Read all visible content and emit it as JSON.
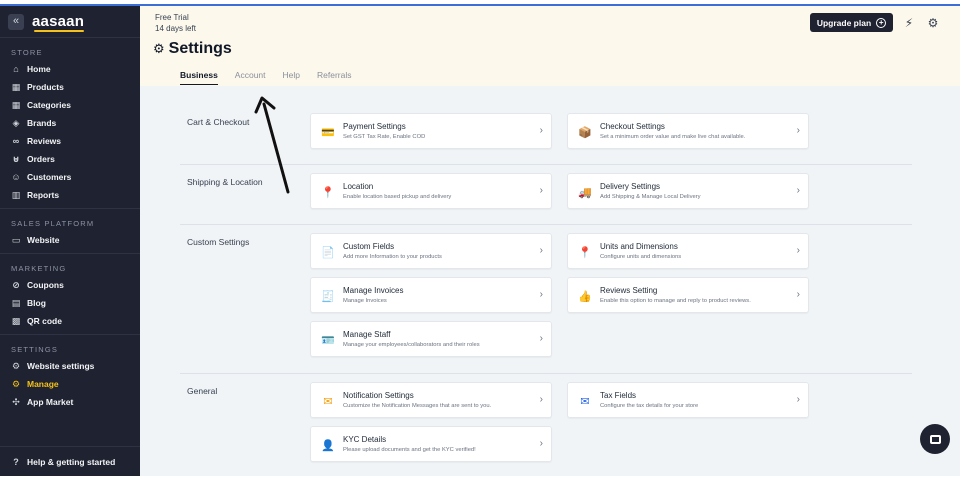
{
  "sidebar": {
    "logo": "aasaan",
    "collapse_icon": "chevrons-left-icon",
    "sections": [
      {
        "title": "STORE",
        "items": [
          {
            "label": "Home",
            "icon": "home-icon",
            "glyph": "⌂"
          },
          {
            "label": "Products",
            "icon": "grid-icon",
            "glyph": "▦"
          },
          {
            "label": "Categories",
            "icon": "categories-icon",
            "glyph": "▦"
          },
          {
            "label": "Brands",
            "icon": "tag-icon",
            "glyph": "◈"
          },
          {
            "label": "Reviews",
            "icon": "link-icon",
            "glyph": "∞"
          },
          {
            "label": "Orders",
            "icon": "cart-icon",
            "glyph": "⊍"
          },
          {
            "label": "Customers",
            "icon": "users-icon",
            "glyph": "☺"
          },
          {
            "label": "Reports",
            "icon": "bar-chart-icon",
            "glyph": "▥"
          }
        ]
      },
      {
        "title": "SALES PLATFORM",
        "items": [
          {
            "label": "Website",
            "icon": "monitor-icon",
            "glyph": "▭"
          }
        ]
      },
      {
        "title": "MARKETING",
        "items": [
          {
            "label": "Coupons",
            "icon": "coupon-icon",
            "glyph": "⊘"
          },
          {
            "label": "Blog",
            "icon": "blog-icon",
            "glyph": "▤"
          },
          {
            "label": "QR code",
            "icon": "qr-icon",
            "glyph": "▩"
          }
        ]
      },
      {
        "title": "SETTINGS",
        "items": [
          {
            "label": "Website settings",
            "icon": "gear-icon",
            "glyph": "⚙"
          },
          {
            "label": "Manage",
            "icon": "gear-icon",
            "glyph": "⚙",
            "active": true
          },
          {
            "label": "App Market",
            "icon": "apps-icon",
            "glyph": "✣"
          }
        ]
      }
    ],
    "help": {
      "label": "Help & getting started",
      "icon": "help-icon",
      "glyph": "?"
    }
  },
  "header": {
    "trial_line1": "Free Trial",
    "trial_line2": "14 days left",
    "upgrade_label": "Upgrade plan",
    "lightning_icon": "lightning-icon",
    "settings_icon": "gear-icon"
  },
  "page": {
    "title": "Settings",
    "tabs": [
      {
        "label": "Business",
        "active": true
      },
      {
        "label": "Account"
      },
      {
        "label": "Help"
      },
      {
        "label": "Referrals"
      }
    ]
  },
  "groups": [
    {
      "label": "Cart & Checkout",
      "cards": [
        {
          "title": "Payment Settings",
          "sub": "Set GST Tax Rate, Enable COD",
          "icon": "credit-card-icon",
          "glyph": "💳",
          "color": "#3b82f6"
        },
        {
          "title": "Checkout Settings",
          "sub": "Set a minimum order value and make live chat available.",
          "icon": "package-icon",
          "glyph": "📦",
          "color": "#b45309"
        }
      ]
    },
    {
      "label": "Shipping & Location",
      "cards": [
        {
          "title": "Location",
          "sub": "Enable location based pickup and delivery",
          "icon": "location-pin-icon",
          "glyph": "📍",
          "color": "#2563eb"
        },
        {
          "title": "Delivery Settings",
          "sub": "Add Shipping & Manage Local Delivery",
          "icon": "delivery-truck-icon",
          "glyph": "🚚",
          "color": "#f59e0b"
        }
      ]
    },
    {
      "label": "Custom Settings",
      "cards": [
        {
          "title": "Custom Fields",
          "sub": "Add more Information to your products",
          "icon": "document-icon",
          "glyph": "📄",
          "color": "#9ca3af"
        },
        {
          "title": "Units and Dimensions",
          "sub": "Configure units and dimensions",
          "icon": "location-pin-icon",
          "glyph": "📍",
          "color": "#2563eb"
        },
        {
          "title": "Manage Invoices",
          "sub": "Manage Invoices",
          "icon": "invoice-icon",
          "glyph": "🧾",
          "color": "#9ca3af"
        },
        {
          "title": "Reviews Setting",
          "sub": "Enable this option to manage and reply to product reviews.",
          "icon": "thumbs-up-icon",
          "glyph": "👍",
          "color": "#3b82f6"
        },
        {
          "title": "Manage Staff",
          "sub": "Manage your employees/collaborators and their roles",
          "icon": "staff-icon",
          "glyph": "🪪",
          "color": "#3b82f6"
        }
      ]
    },
    {
      "label": "General",
      "cards": [
        {
          "title": "Notification Settings",
          "sub": "Customize the Notification Messages that are sent to you.",
          "icon": "notification-icon",
          "glyph": "✉",
          "color": "#f59e0b"
        },
        {
          "title": "Tax Fields",
          "sub": "Configure the tax details for your store",
          "icon": "envelope-icon",
          "glyph": "✉",
          "color": "#2563eb"
        },
        {
          "title": "KYC Details",
          "sub": "Please upload documents and get the KYC verified!",
          "icon": "kyc-icon",
          "glyph": "👤",
          "color": "#ef4444"
        }
      ]
    }
  ],
  "chat": {
    "icon": "chat-icon"
  }
}
